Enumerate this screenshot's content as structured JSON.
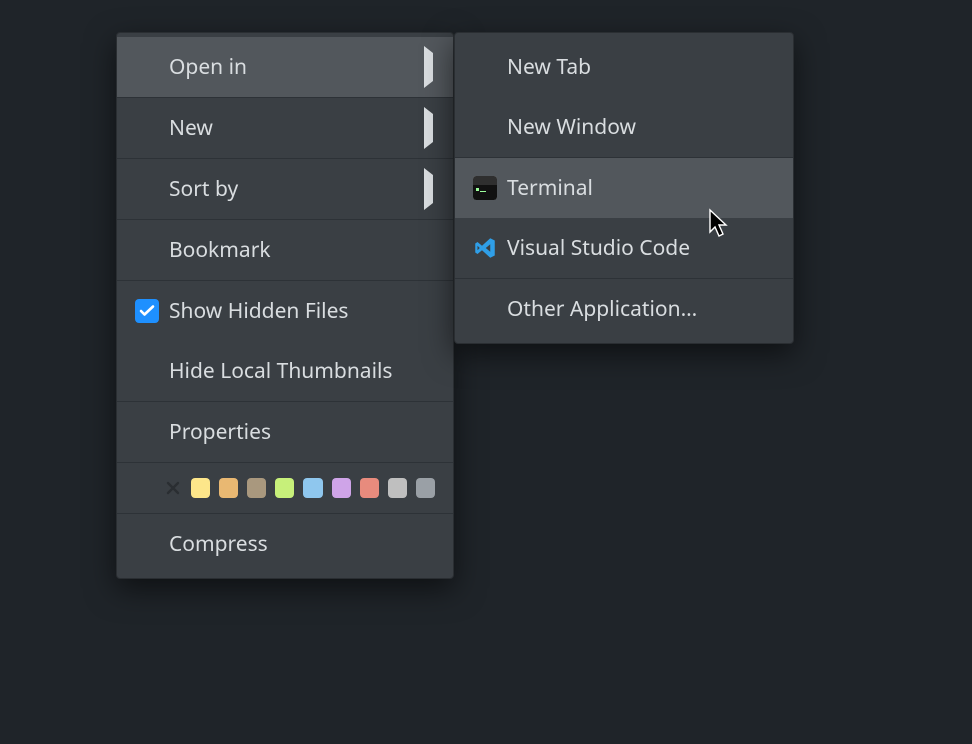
{
  "main_menu": {
    "open_in": "Open in",
    "new": "New",
    "sort_by": "Sort by",
    "bookmark": "Bookmark",
    "show_hidden": "Show Hidden Files",
    "hide_thumbs": "Hide Local Thumbnails",
    "properties": "Properties",
    "compress": "Compress"
  },
  "submenu": {
    "new_tab": "New Tab",
    "new_window": "New Window",
    "terminal": "Terminal",
    "vscode": "Visual Studio Code",
    "other_app": "Other Application…"
  },
  "state": {
    "show_hidden_checked": true,
    "highlighted_main": "open_in",
    "highlighted_sub": "terminal"
  },
  "swatches": [
    "#fde68a",
    "#e9b872",
    "#a9987e",
    "#c7f07a",
    "#8fc7ee",
    "#cfa4e8",
    "#e88b7d",
    "#bfbfbf",
    "#9aa0a6"
  ]
}
